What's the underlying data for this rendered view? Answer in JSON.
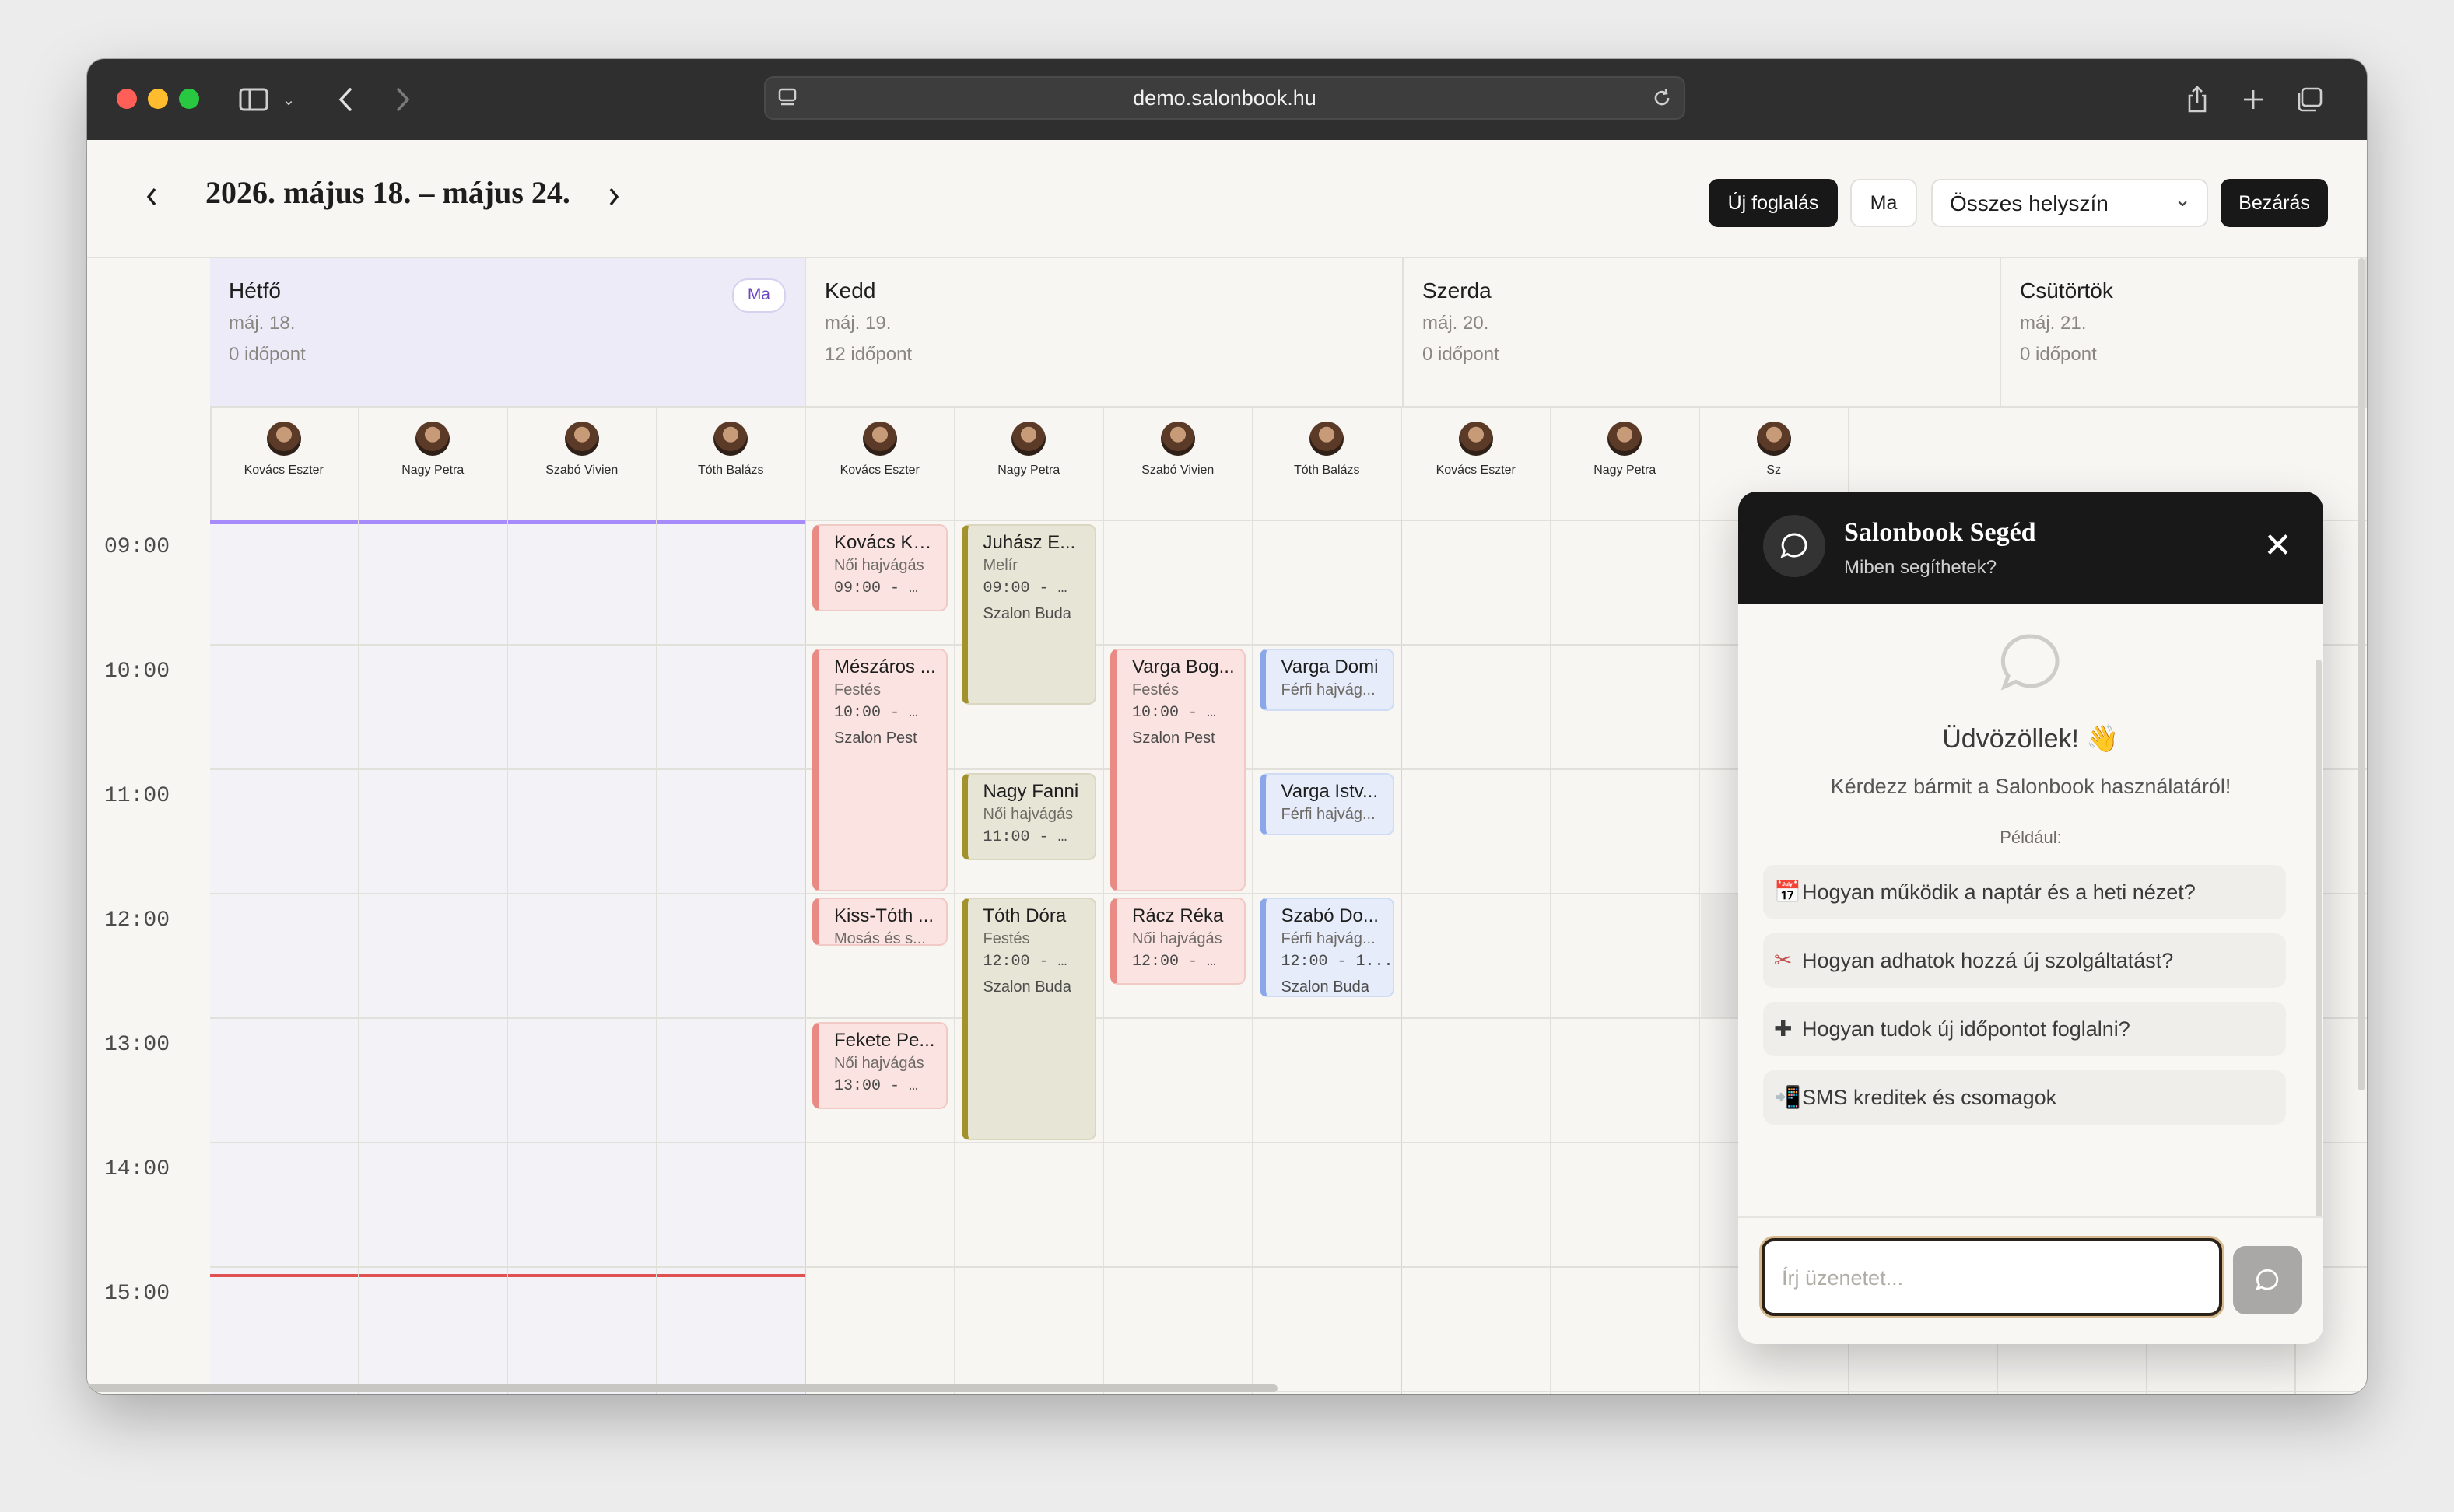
{
  "browser": {
    "url": "demo.salonbook.hu",
    "icons": [
      "sidebar-icon",
      "chevron-down-icon",
      "back-icon",
      "forward-icon",
      "reader-icon",
      "reload-icon",
      "share-icon",
      "new-tab-icon",
      "tabs-overview-icon"
    ]
  },
  "header": {
    "range_title": "2026. május 18. – május 24.",
    "new_booking": "Új foglalás",
    "today": "Ma",
    "location_select": "Összes helyszín",
    "close": "Bezárás"
  },
  "days": [
    {
      "name": "Hétfő",
      "date": "máj. 18.",
      "count": "0 időpont",
      "badge": "Ma"
    },
    {
      "name": "Kedd",
      "date": "máj. 19.",
      "count": "12 időpont"
    },
    {
      "name": "Szerda",
      "date": "máj. 20.",
      "count": "0 időpont"
    },
    {
      "name": "Csütörtök",
      "date": "máj. 21.",
      "count": "0 időpont"
    }
  ],
  "staff": [
    "Kovács Eszter",
    "Nagy Petra",
    "Szabó Vivien",
    "Tóth Balázs",
    "Kovács Eszter",
    "Nagy Petra",
    "Szabó Vivien",
    "Tóth Balázs",
    "Kovács Eszter",
    "Nagy Petra",
    "Sz"
  ],
  "times": [
    "09:00",
    "10:00",
    "11:00",
    "12:00",
    "13:00",
    "14:00",
    "15:00"
  ],
  "appointments": [
    {
      "name": "Kovács Ka...",
      "service": "Női hajvágás",
      "time": "09:00 - …",
      "location": ""
    },
    {
      "name": "Mészáros ...",
      "service": "Festés",
      "time": "10:00 - …",
      "location": "Szalon Pest"
    },
    {
      "name": "Kiss-Tóth ...",
      "service": "Mosás és s...",
      "time": "",
      "location": ""
    },
    {
      "name": "Fekete Pe...",
      "service": "Női hajvágás",
      "time": "13:00 - …",
      "location": ""
    },
    {
      "name": "Juhász E...",
      "service": "Melír",
      "time": "09:00 - …",
      "location": "Szalon Buda"
    },
    {
      "name": "Nagy Fanni",
      "service": "Női hajvágás",
      "time": "11:00 - …",
      "location": ""
    },
    {
      "name": "Tóth Dóra",
      "service": "Festés",
      "time": "12:00 - …",
      "location": "Szalon Buda"
    },
    {
      "name": "Varga Bog...",
      "service": "Festés",
      "time": "10:00 - …",
      "location": "Szalon Pest"
    },
    {
      "name": "Rácz Réka",
      "service": "Női hajvágás",
      "time": "12:00 - …",
      "location": ""
    },
    {
      "name": "Varga Domi",
      "service": "Férfi hajvág...",
      "time": "",
      "location": ""
    },
    {
      "name": "Varga Istv...",
      "service": "Férfi hajvág...",
      "time": "",
      "location": ""
    },
    {
      "name": "Szabó Do...",
      "service": "Férfi hajvág...",
      "time": "12:00 - 1...",
      "location": "Szalon Buda"
    }
  ],
  "chat": {
    "title": "Salonbook Segéd",
    "subtitle": "Miben segíthetek?",
    "welcome": "Üdvözöllek! 👋",
    "welcome_sub": "Kérdezz bármit a Salonbook használatáról!",
    "examples_label": "Például:",
    "suggestions": [
      {
        "icon": "calendar-icon",
        "glyph": "📅",
        "text": "Hogyan működik a naptár és a heti nézet?"
      },
      {
        "icon": "scissors-icon",
        "glyph": "✂",
        "text": "Hogyan adhatok hozzá új szolgáltatást?"
      },
      {
        "icon": "plus-icon",
        "glyph": "✚",
        "text": "Hogyan tudok új időpontot foglalni?"
      },
      {
        "icon": "sms-phone-icon",
        "glyph": "📲",
        "text": "SMS kreditek és csomagok"
      }
    ],
    "input_placeholder": "Írj üzenetet..."
  },
  "colors": {
    "today_bg": "#eeebf9",
    "now_line": "#a78bfa",
    "current_time_line": "#e53e3e",
    "appt_red_bg": "#fae3e1",
    "appt_olive_bg": "#e7e5d6",
    "appt_blue_bg": "#e6ecfa"
  }
}
